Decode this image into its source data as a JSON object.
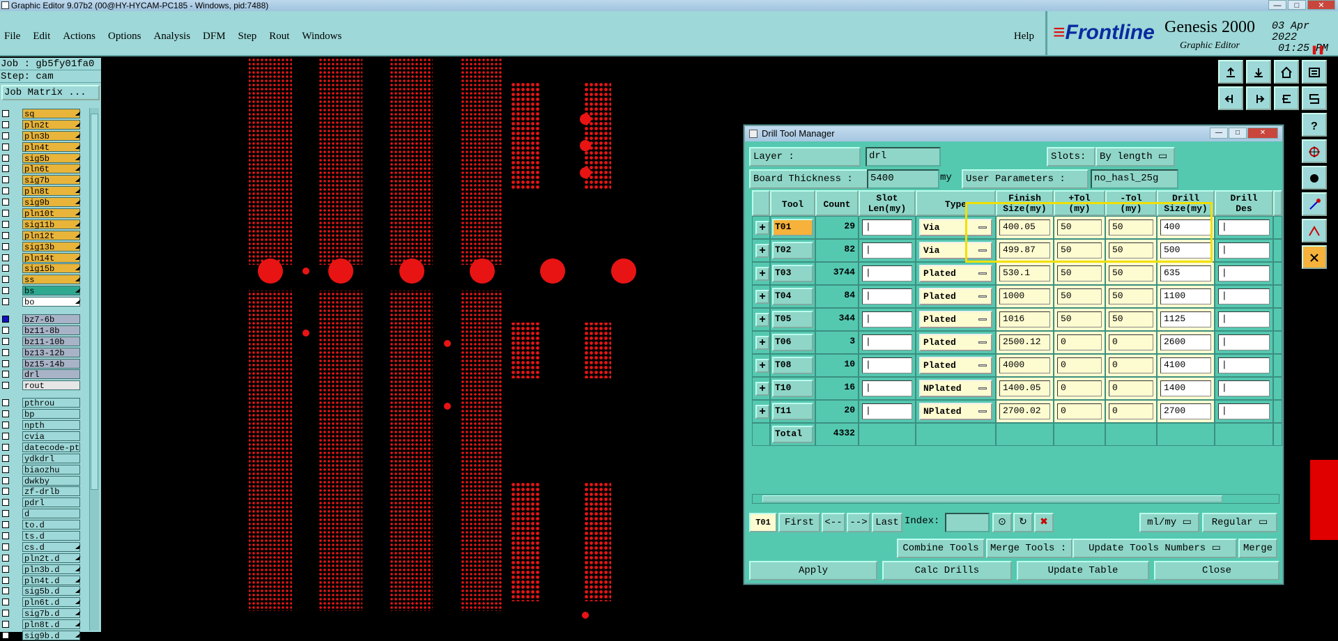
{
  "window": {
    "title": "Graphic Editor 9.07b2 (00@HY-HYCAM-PC185 - Windows, pid:7488)",
    "controls": [
      "—",
      "□",
      "✕"
    ]
  },
  "menu": {
    "items": [
      "File",
      "Edit",
      "Actions",
      "Options",
      "Analysis",
      "DFM",
      "Step",
      "Rout",
      "Windows"
    ],
    "help": "Help"
  },
  "brand": {
    "logo": "Frontline",
    "product": "Genesis 2000",
    "subtitle": "Graphic Editor",
    "date": "03 Apr 2022",
    "time": "01:25 PM"
  },
  "left_panel": {
    "job": "Job : gb5fy01fa0",
    "step": "Step: cam",
    "matrix_button": "Job Matrix ...",
    "layers_group1": [
      {
        "name": "sq",
        "color": "#e8b43a"
      },
      {
        "name": "pln2t",
        "color": "#e8b43a"
      },
      {
        "name": "pln3b",
        "color": "#e8b43a"
      },
      {
        "name": "pln4t",
        "color": "#e8b43a"
      },
      {
        "name": "sig5b",
        "color": "#e8b43a"
      },
      {
        "name": "pln6t",
        "color": "#e8b43a"
      },
      {
        "name": "sig7b",
        "color": "#e8b43a"
      },
      {
        "name": "pln8t",
        "color": "#e8b43a"
      },
      {
        "name": "sig9b",
        "color": "#e8b43a"
      },
      {
        "name": "pln10t",
        "color": "#e8b43a"
      },
      {
        "name": "sig11b",
        "color": "#e8b43a"
      },
      {
        "name": "pln12t",
        "color": "#e8b43a"
      },
      {
        "name": "sig13b",
        "color": "#e8b43a"
      },
      {
        "name": "pln14t",
        "color": "#e8b43a"
      },
      {
        "name": "sig15b",
        "color": "#e8b43a"
      },
      {
        "name": "ss",
        "color": "#e8b43a"
      },
      {
        "name": "bs",
        "color": "#2fa890"
      },
      {
        "name": "bo",
        "color": "#ffffff"
      }
    ],
    "layers_group2": [
      {
        "name": "bz7-6b",
        "color": "#a9b3c7"
      },
      {
        "name": "bz11-8b",
        "color": "#a9b3c7"
      },
      {
        "name": "bz11-10b",
        "color": "#a9b3c7"
      },
      {
        "name": "bz13-12b",
        "color": "#a9b3c7"
      },
      {
        "name": "bz15-14b",
        "color": "#a9b3c7"
      },
      {
        "name": "drl",
        "color": "#a9b3c7"
      },
      {
        "name": "rout",
        "color": "#e6e6e6"
      }
    ],
    "layers_group3": [
      {
        "name": "pthrou",
        "color": "#9ed8d8"
      },
      {
        "name": "bp",
        "color": "#9ed8d8"
      },
      {
        "name": "npth",
        "color": "#9ed8d8"
      },
      {
        "name": "cvia",
        "color": "#9ed8d8"
      },
      {
        "name": "datecode-pth",
        "color": "#9ed8d8"
      },
      {
        "name": "ydkdrl",
        "color": "#9ed8d8"
      },
      {
        "name": "biaozhu",
        "color": "#9ed8d8"
      },
      {
        "name": "dwkby",
        "color": "#9ed8d8"
      },
      {
        "name": "zf-drlb",
        "color": "#9ed8d8"
      },
      {
        "name": "pdrl",
        "color": "#9ed8d8"
      },
      {
        "name": "d",
        "color": "#9ed8d8"
      },
      {
        "name": "to.d",
        "color": "#9ed8d8"
      },
      {
        "name": "ts.d",
        "color": "#9ed8d8"
      },
      {
        "name": "cs.d",
        "color": "#9ed8d8"
      },
      {
        "name": "pln2t.d",
        "color": "#9ed8d8"
      },
      {
        "name": "pln3b.d",
        "color": "#9ed8d8"
      },
      {
        "name": "pln4t.d",
        "color": "#9ed8d8"
      },
      {
        "name": "sig5b.d",
        "color": "#9ed8d8"
      },
      {
        "name": "pln6t.d",
        "color": "#9ed8d8"
      },
      {
        "name": "sig7b.d",
        "color": "#9ed8d8"
      },
      {
        "name": "pln8t.d",
        "color": "#9ed8d8"
      },
      {
        "name": "sig9b.d",
        "color": "#9ed8d8"
      }
    ]
  },
  "dialog": {
    "title": "Drill Tool Manager",
    "layer_label": "Layer           :",
    "layer_value": "drl",
    "slots_label": "Slots:",
    "slots_value": "By length",
    "thickness_label": "Board Thickness :",
    "thickness_value": "5400",
    "thickness_unit": "my",
    "user_params_label": "User Parameters :",
    "user_params_value": "no_hasl_25g",
    "columns": {
      "tool": "Tool",
      "count": "Count",
      "slot1": "Slot",
      "slot2": "Len(my)",
      "type": "Type",
      "finish1": "Finish",
      "finish2": "Size(my)",
      "ptol1": "+Tol",
      "ptol2": "(my)",
      "mtol1": "-Tol",
      "mtol2": "(my)",
      "drill1": "Drill",
      "drill2": "Size(my)",
      "des1": "Drill",
      "des2": "Des"
    },
    "rows": [
      {
        "tool": "T01",
        "count": "29",
        "type": "Via",
        "finish": "400.05",
        "ptol": "50",
        "mtol": "50",
        "drill": "400"
      },
      {
        "tool": "T02",
        "count": "82",
        "type": "Via",
        "finish": "499.87",
        "ptol": "50",
        "mtol": "50",
        "drill": "500"
      },
      {
        "tool": "T03",
        "count": "3744",
        "type": "Plated",
        "finish": "530.1",
        "ptol": "50",
        "mtol": "50",
        "drill": "635"
      },
      {
        "tool": "T04",
        "count": "84",
        "type": "Plated",
        "finish": "1000",
        "ptol": "50",
        "mtol": "50",
        "drill": "1100"
      },
      {
        "tool": "T05",
        "count": "344",
        "type": "Plated",
        "finish": "1016",
        "ptol": "50",
        "mtol": "50",
        "drill": "1125"
      },
      {
        "tool": "T06",
        "count": "3",
        "type": "Plated",
        "finish": "2500.12",
        "ptol": "0",
        "mtol": "0",
        "drill": "2600"
      },
      {
        "tool": "T08",
        "count": "10",
        "type": "Plated",
        "finish": "4000",
        "ptol": "0",
        "mtol": "0",
        "drill": "4100"
      },
      {
        "tool": "T10",
        "count": "16",
        "type": "NPlated",
        "finish": "1400.05",
        "ptol": "0",
        "mtol": "0",
        "drill": "1400"
      },
      {
        "tool": "T11",
        "count": "20",
        "type": "NPlated",
        "finish": "2700.02",
        "ptol": "0",
        "mtol": "0",
        "drill": "2700"
      }
    ],
    "total_label": "Total",
    "total_count": "4332",
    "nav": {
      "current": "T01",
      "first": "First",
      "prev": "<--",
      "next": "-->",
      "last": "Last",
      "index_label": "Index:",
      "units": "ml/my",
      "mode": "Regular"
    },
    "actions_row1": {
      "combine": "Combine Tools",
      "merge_label": "Merge Tools :",
      "merge_option": "Update Tools Numbers",
      "merge_btn": "Merge"
    },
    "actions_row2": {
      "apply": "Apply",
      "calc": "Calc Drills",
      "update": "Update Table",
      "close": "Close"
    }
  },
  "toolbar_icons": [
    "upload-icon",
    "download-icon",
    "home-icon",
    "tray-icon",
    "import-icon",
    "export-icon",
    "undo-icon",
    "snake-icon",
    "help-icon",
    "cross-hair-icon",
    "dots-icon",
    "line-icon",
    "arc-icon",
    "highlight-icon"
  ]
}
